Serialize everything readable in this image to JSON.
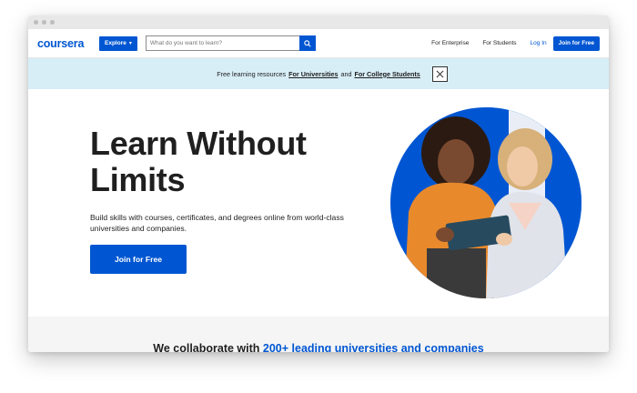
{
  "nav": {
    "logo": "coursera",
    "explore_label": "Explore",
    "search_placeholder": "What do you want to learn?",
    "for_enterprise": "For Enterprise",
    "for_students": "For Students",
    "login": "Log In",
    "join": "Join for Free"
  },
  "banner": {
    "lead": "Free learning resources",
    "link_universities": "For Universities",
    "amp": "and",
    "link_students": "For College Students"
  },
  "hero": {
    "title_line1": "Learn Without",
    "title_line2": "Limits",
    "description": "Build skills with courses, certificates, and degrees online from world-class universities and companies.",
    "join_label": "Join for Free"
  },
  "partners": {
    "lead": "We collaborate with",
    "highlight": "200+ leading universities and companies"
  },
  "colors": {
    "brand": "#0056d2",
    "banner_bg": "#d8eef7"
  }
}
